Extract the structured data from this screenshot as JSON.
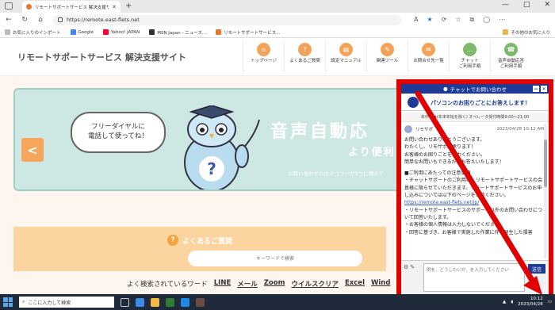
{
  "browser": {
    "tab_title": "リモートサポートサービス 解決支援サイト",
    "new_tab": "+",
    "url": "https://remote.east-flets.net",
    "window_controls": [
      "—",
      "□",
      "✕"
    ]
  },
  "bookmarks": {
    "items": [
      "お気に入りのインポート",
      "Google",
      "Yahoo! JAPAN",
      "MSN Japan - ニュース...",
      "リモートサポートサービス..."
    ],
    "other": "その他のお気に入り"
  },
  "site": {
    "title": "リモートサポートサービス 解決支援サイト",
    "nav": [
      {
        "label": "トップページ",
        "icon": "home-icon",
        "color": "#f3a25a"
      },
      {
        "label": "よくあるご質問",
        "icon": "question-icon",
        "color": "#f3a25a"
      },
      {
        "label": "設定マニュアル",
        "icon": "book-icon",
        "color": "#f3a25a"
      },
      {
        "label": "関連ツール",
        "icon": "tool-icon",
        "color": "#f3a25a"
      },
      {
        "label": "お問合せ先一覧",
        "icon": "mail-icon",
        "color": "#f3a25a"
      },
      {
        "label": "チャット\nご利用手順",
        "icon": "chat-icon",
        "color": "#7cba6a"
      },
      {
        "label": "音声自動応答\nご利用手順",
        "icon": "phone-icon",
        "color": "#7cba6a"
      }
    ]
  },
  "banner": {
    "prev": "<",
    "bubble": "フリーダイヤルに\n電話して使ってね！",
    "headline": "音声自動応",
    "sub": "より便利に",
    "note": "お問い合わせのカテゴリーが3つに増えて"
  },
  "faq": {
    "title": "よくあるご質問",
    "q": "?",
    "search_placeholder": "キーワードで検索"
  },
  "popular": {
    "label": "よく検索されているワード",
    "keywords": [
      "LINE",
      "メール",
      "Zoom",
      "ウイルスクリア",
      "Excel",
      "Wind"
    ]
  },
  "chat": {
    "header": "チャットでお問い合わせ",
    "title": "パソコンのお困りごとにお答えします！",
    "hours": "年中無休(年末年始を除く)  オペレータ受付時間9:00〜21:00",
    "sender": "リモサポ",
    "time": "2023/04/28 10:12 AM",
    "message_lines": "お問い合わせありがとうございます。\nわたくし、リモサポが承ります！\nお客様のお困りごとを入力ください。\n簡単なお問いもできるだけお答えいたします！",
    "notice": "■ご利用にあたっての注意事項\n・チャットサポートのご利用は、リモートサポートサービスの会員様に限らせていただきます。リモートサポートサービスのお申し込みについては以下のページをご覧ください。",
    "link": "https://remote.east-flets.net/jp/",
    "notice2": "・リモートサポートサービスのサポート以外のお問い合わせについて回答いたします。\n・お客様の個人情報は入力しないでください。\n・回答に基づき、お客様で実施した作業に伴い発生した損害",
    "input_placeholder": "例を、どうしたいか、を入力してください",
    "send": "送信"
  },
  "taskbar": {
    "search_placeholder": "ここに入力して検索",
    "time": "10:12",
    "date": "2023/04/28",
    "apps": [
      "#3c8ce7",
      "#f5b942",
      "#2e7d32",
      "#e53935",
      "#1e88e5",
      "#6d4c41"
    ]
  },
  "colors": {
    "accent_orange": "#f3a25a",
    "accent_green": "#7cba6a",
    "chat_blue": "#1c3a96",
    "highlight_red": "#e00000"
  }
}
